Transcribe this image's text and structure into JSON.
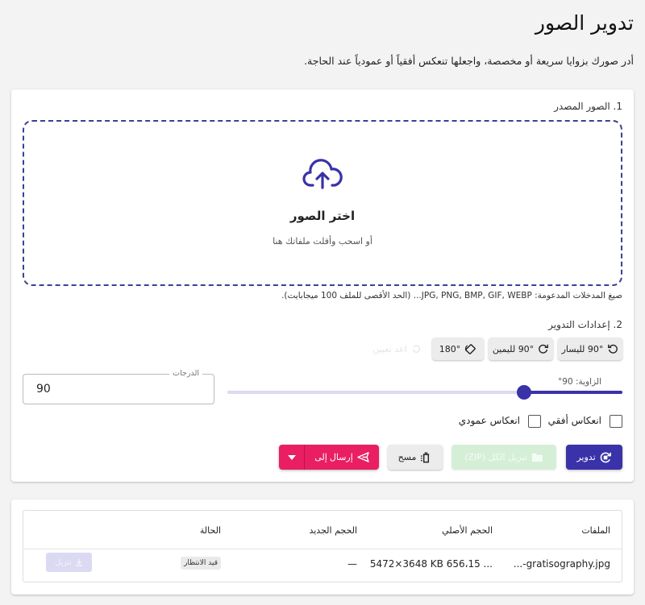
{
  "page": {
    "title": "تدوير الصور",
    "description": "أدر صورك بزوايا سريعة أو مخصصة، واجعلها تنعكس أفقياً أو عمودياً عند الحاجة."
  },
  "source": {
    "section_label": "1. الصور المصدر",
    "dropzone_title": "اختر الصور",
    "dropzone_subtitle": "أو اسحب وأفلت ملفاتك هنا",
    "formats_note": "صيغ المدخلات المدعومة: JPG, PNG, BMP, GIF, WEBP... (الحد الأقصى للملف 100 ميجابايت)."
  },
  "settings": {
    "section_label": "2. إعدادات التدوير",
    "quick": {
      "rotate_left": "90° لليسار",
      "rotate_right": "90° لليمين",
      "rotate_180": "180°",
      "ghost": "اعد تعيين"
    },
    "degrees_label": "الدرجات",
    "degrees_value": "90",
    "angle_label": "الزاوية: 90°",
    "angle_fraction": 0.25,
    "flip_horizontal": "انعكاس أفقي",
    "flip_vertical": "انعكاس عمودي"
  },
  "actions": {
    "rotate": "تدوير",
    "download_zip": "تنزيل الكل (ZIP)",
    "clear": "مسح",
    "send_to": "إرسال إلى"
  },
  "table": {
    "headers": {
      "files": "الملفات",
      "original_size": "الحجم الأصلي",
      "new_size": "الحجم الجديد",
      "status": "الحالة"
    },
    "rows": [
      {
        "file": "gratisography.jpg-...",
        "original": "5472×3648 KB 656،15 ...",
        "new": "—",
        "status": "قيد الانتظار",
        "download": "تنزيل"
      }
    ]
  },
  "colors": {
    "primary": "#3a32a8",
    "accent": "#e91e63",
    "success_disabled": "#d5efd7"
  },
  "icons": {
    "upload": "cloud-upload-icon",
    "rotate_left": "rotate-left-icon",
    "rotate_right": "rotate-right-icon",
    "rotate_180": "rotate-180-icon",
    "rotate": "rotate-action-icon",
    "zip": "folder-zip-icon",
    "clear": "trash-icon",
    "send": "send-icon",
    "dropdown": "caret-down-icon",
    "download": "download-icon"
  }
}
